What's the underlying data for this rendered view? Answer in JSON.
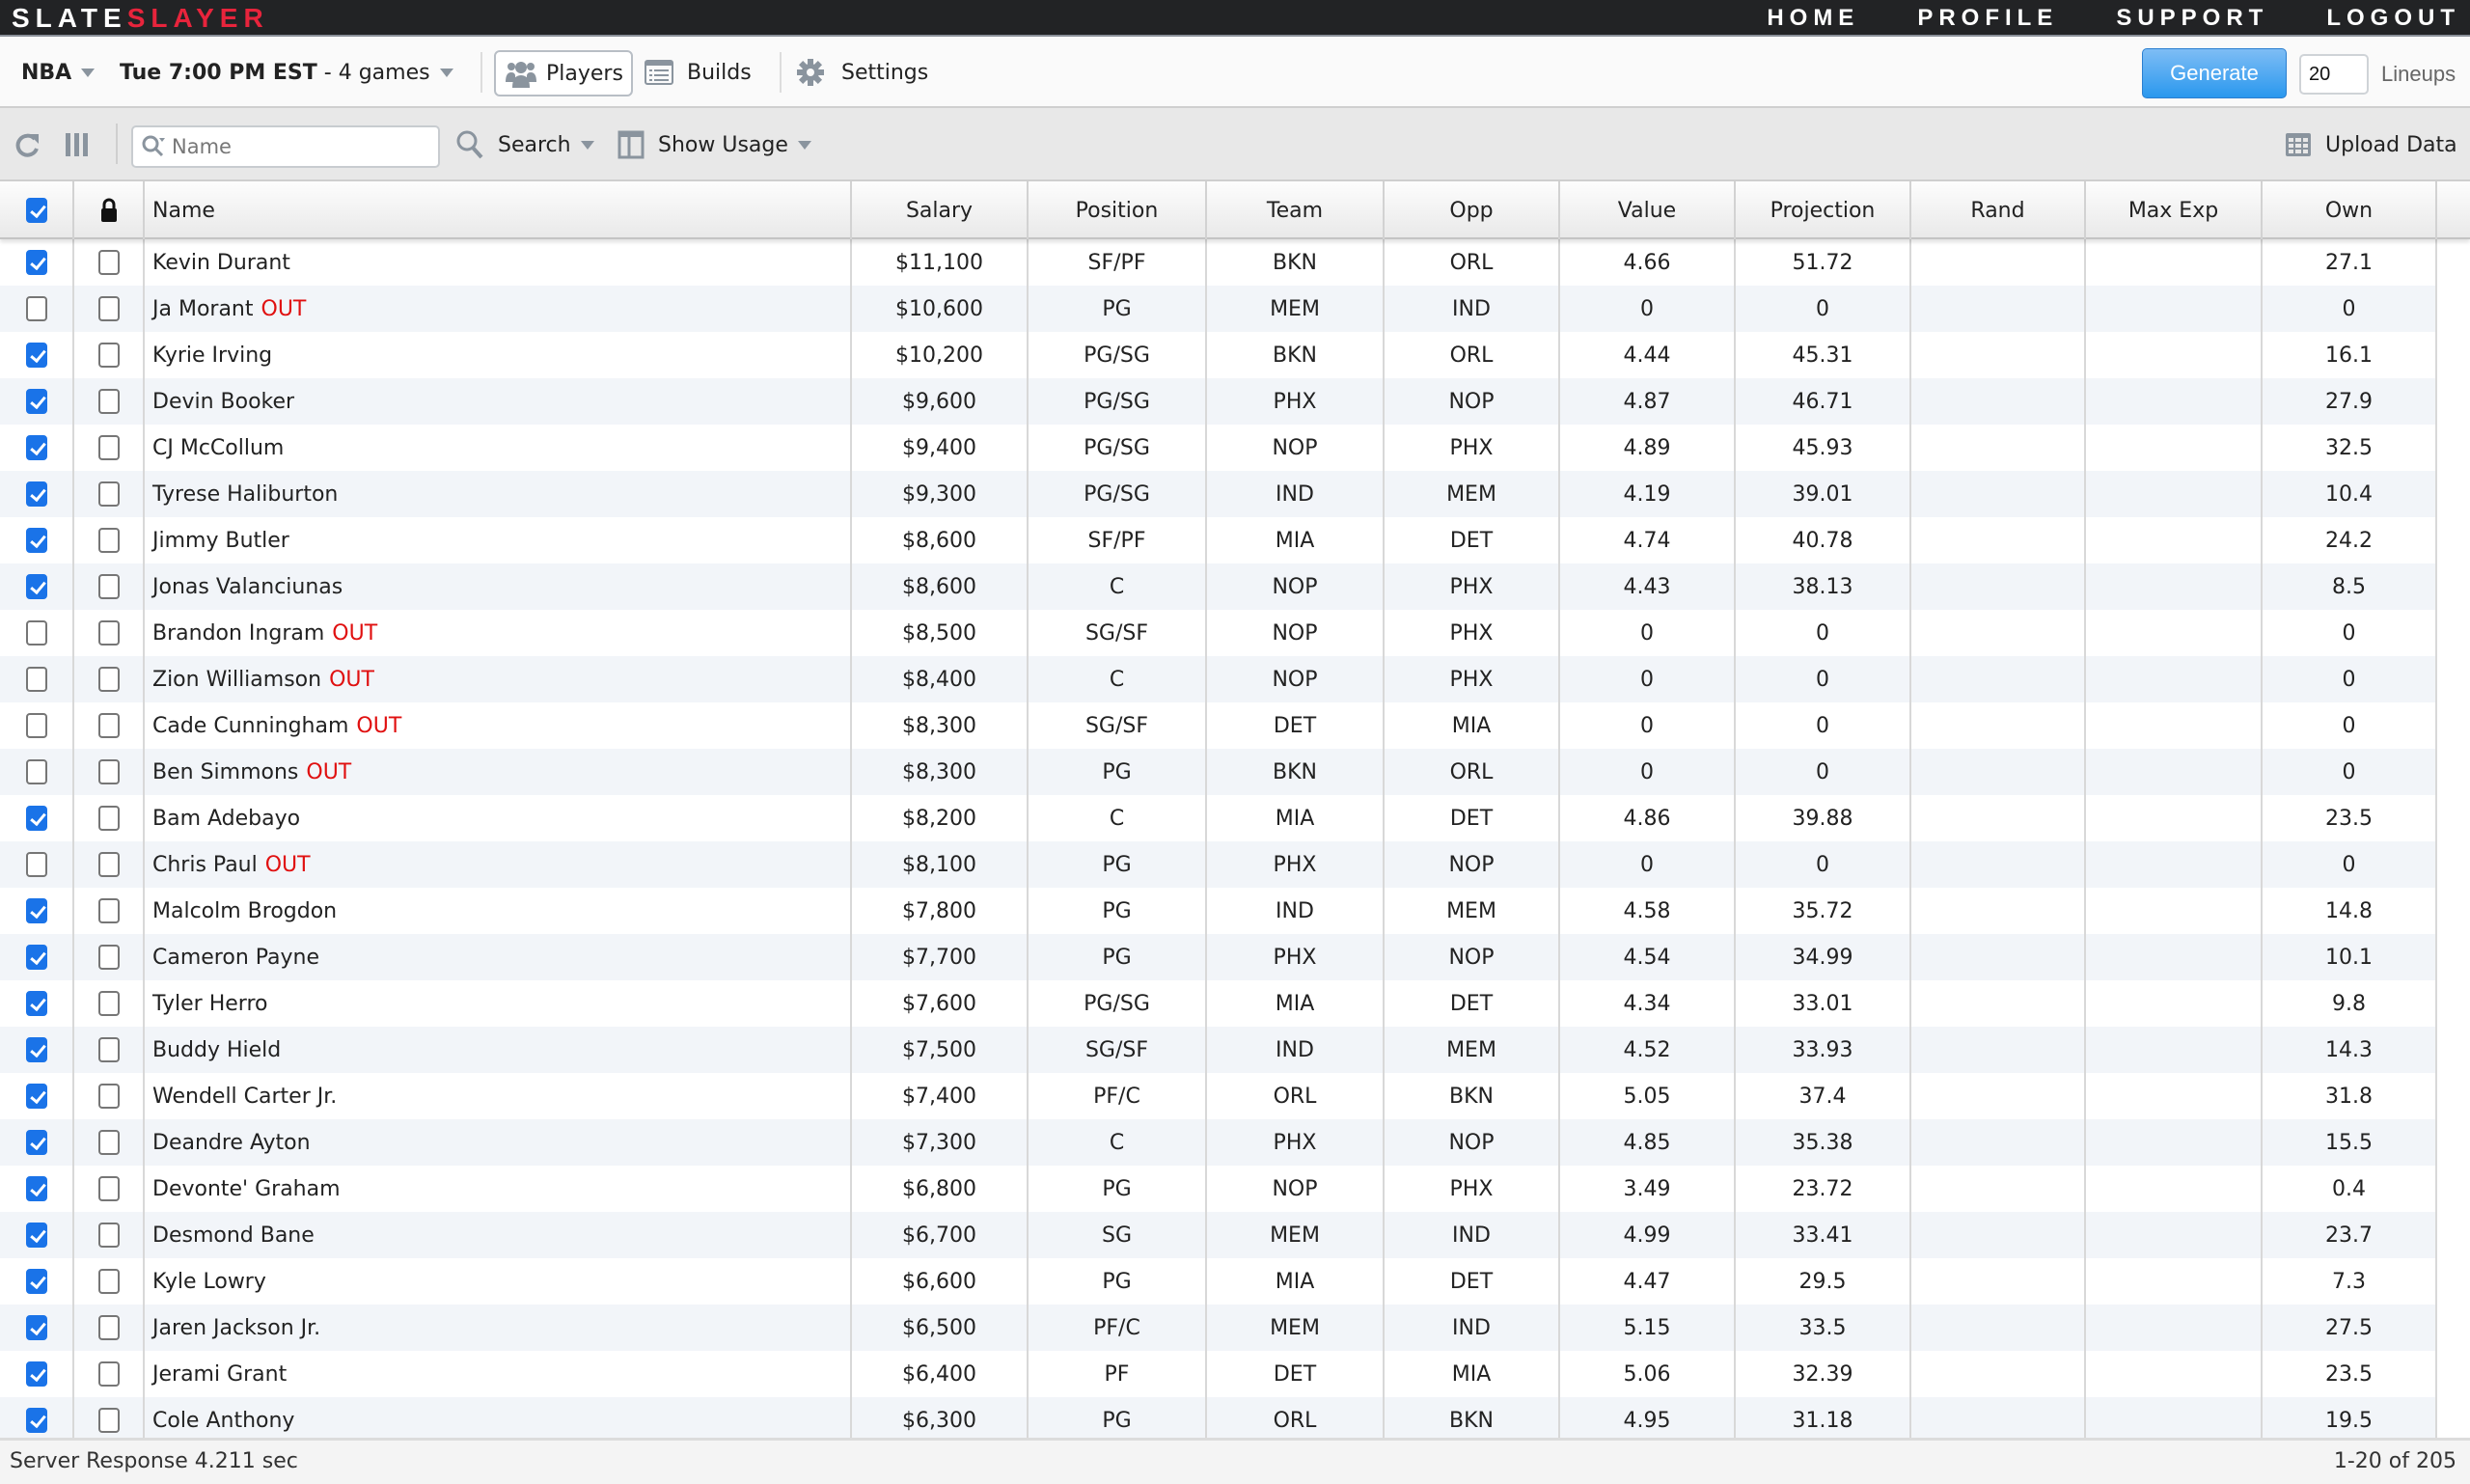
{
  "brand": {
    "part1": "SLATE",
    "part2": "SLAYER"
  },
  "nav": {
    "links": [
      "HOME",
      "PROFILE",
      "SUPPORT",
      "LOGOUT"
    ]
  },
  "toolbar": {
    "sport": "NBA",
    "slate_time": "Tue 7:00 PM EST",
    "slate_games": " - 4 games",
    "tabs": {
      "players": "Players",
      "builds": "Builds",
      "settings": "Settings"
    },
    "generate_label": "Generate",
    "lineups_value": "20",
    "lineups_label": "Lineups"
  },
  "filterbar": {
    "name_placeholder": "Name",
    "search_label": "Search",
    "show_usage_label": "Show Usage",
    "upload_label": "Upload Data"
  },
  "table": {
    "columns": [
      "Name",
      "Salary",
      "Position",
      "Team",
      "Opp",
      "Value",
      "Projection",
      "Rand",
      "Max Exp",
      "Own"
    ],
    "select_all_checked": true,
    "out_label": "OUT",
    "rows": [
      {
        "checked": true,
        "locked": false,
        "name": "Kevin Durant",
        "out": false,
        "salary": "$11,100",
        "position": "SF/PF",
        "team": "BKN",
        "opp": "ORL",
        "value": "4.66",
        "projection": "51.72",
        "rand": "",
        "max_exp": "",
        "own": "27.1"
      },
      {
        "checked": false,
        "locked": false,
        "name": "Ja Morant",
        "out": true,
        "salary": "$10,600",
        "position": "PG",
        "team": "MEM",
        "opp": "IND",
        "value": "0",
        "projection": "0",
        "rand": "",
        "max_exp": "",
        "own": "0"
      },
      {
        "checked": true,
        "locked": false,
        "name": "Kyrie Irving",
        "out": false,
        "salary": "$10,200",
        "position": "PG/SG",
        "team": "BKN",
        "opp": "ORL",
        "value": "4.44",
        "projection": "45.31",
        "rand": "",
        "max_exp": "",
        "own": "16.1"
      },
      {
        "checked": true,
        "locked": false,
        "name": "Devin Booker",
        "out": false,
        "salary": "$9,600",
        "position": "PG/SG",
        "team": "PHX",
        "opp": "NOP",
        "value": "4.87",
        "projection": "46.71",
        "rand": "",
        "max_exp": "",
        "own": "27.9"
      },
      {
        "checked": true,
        "locked": false,
        "name": "CJ McCollum",
        "out": false,
        "salary": "$9,400",
        "position": "PG/SG",
        "team": "NOP",
        "opp": "PHX",
        "value": "4.89",
        "projection": "45.93",
        "rand": "",
        "max_exp": "",
        "own": "32.5"
      },
      {
        "checked": true,
        "locked": false,
        "name": "Tyrese Haliburton",
        "out": false,
        "salary": "$9,300",
        "position": "PG/SG",
        "team": "IND",
        "opp": "MEM",
        "value": "4.19",
        "projection": "39.01",
        "rand": "",
        "max_exp": "",
        "own": "10.4"
      },
      {
        "checked": true,
        "locked": false,
        "name": "Jimmy Butler",
        "out": false,
        "salary": "$8,600",
        "position": "SF/PF",
        "team": "MIA",
        "opp": "DET",
        "value": "4.74",
        "projection": "40.78",
        "rand": "",
        "max_exp": "",
        "own": "24.2"
      },
      {
        "checked": true,
        "locked": false,
        "name": "Jonas Valanciunas",
        "out": false,
        "salary": "$8,600",
        "position": "C",
        "team": "NOP",
        "opp": "PHX",
        "value": "4.43",
        "projection": "38.13",
        "rand": "",
        "max_exp": "",
        "own": "8.5"
      },
      {
        "checked": false,
        "locked": false,
        "name": "Brandon Ingram",
        "out": true,
        "salary": "$8,500",
        "position": "SG/SF",
        "team": "NOP",
        "opp": "PHX",
        "value": "0",
        "projection": "0",
        "rand": "",
        "max_exp": "",
        "own": "0"
      },
      {
        "checked": false,
        "locked": false,
        "name": "Zion Williamson",
        "out": true,
        "salary": "$8,400",
        "position": "C",
        "team": "NOP",
        "opp": "PHX",
        "value": "0",
        "projection": "0",
        "rand": "",
        "max_exp": "",
        "own": "0"
      },
      {
        "checked": false,
        "locked": false,
        "name": "Cade Cunningham",
        "out": true,
        "salary": "$8,300",
        "position": "SG/SF",
        "team": "DET",
        "opp": "MIA",
        "value": "0",
        "projection": "0",
        "rand": "",
        "max_exp": "",
        "own": "0"
      },
      {
        "checked": false,
        "locked": false,
        "name": "Ben Simmons",
        "out": true,
        "salary": "$8,300",
        "position": "PG",
        "team": "BKN",
        "opp": "ORL",
        "value": "0",
        "projection": "0",
        "rand": "",
        "max_exp": "",
        "own": "0"
      },
      {
        "checked": true,
        "locked": false,
        "name": "Bam Adebayo",
        "out": false,
        "salary": "$8,200",
        "position": "C",
        "team": "MIA",
        "opp": "DET",
        "value": "4.86",
        "projection": "39.88",
        "rand": "",
        "max_exp": "",
        "own": "23.5"
      },
      {
        "checked": false,
        "locked": false,
        "name": "Chris Paul",
        "out": true,
        "salary": "$8,100",
        "position": "PG",
        "team": "PHX",
        "opp": "NOP",
        "value": "0",
        "projection": "0",
        "rand": "",
        "max_exp": "",
        "own": "0"
      },
      {
        "checked": true,
        "locked": false,
        "name": "Malcolm Brogdon",
        "out": false,
        "salary": "$7,800",
        "position": "PG",
        "team": "IND",
        "opp": "MEM",
        "value": "4.58",
        "projection": "35.72",
        "rand": "",
        "max_exp": "",
        "own": "14.8"
      },
      {
        "checked": true,
        "locked": false,
        "name": "Cameron Payne",
        "out": false,
        "salary": "$7,700",
        "position": "PG",
        "team": "PHX",
        "opp": "NOP",
        "value": "4.54",
        "projection": "34.99",
        "rand": "",
        "max_exp": "",
        "own": "10.1"
      },
      {
        "checked": true,
        "locked": false,
        "name": "Tyler Herro",
        "out": false,
        "salary": "$7,600",
        "position": "PG/SG",
        "team": "MIA",
        "opp": "DET",
        "value": "4.34",
        "projection": "33.01",
        "rand": "",
        "max_exp": "",
        "own": "9.8"
      },
      {
        "checked": true,
        "locked": false,
        "name": "Buddy Hield",
        "out": false,
        "salary": "$7,500",
        "position": "SG/SF",
        "team": "IND",
        "opp": "MEM",
        "value": "4.52",
        "projection": "33.93",
        "rand": "",
        "max_exp": "",
        "own": "14.3"
      },
      {
        "checked": true,
        "locked": false,
        "name": "Wendell Carter Jr.",
        "out": false,
        "salary": "$7,400",
        "position": "PF/C",
        "team": "ORL",
        "opp": "BKN",
        "value": "5.05",
        "projection": "37.4",
        "rand": "",
        "max_exp": "",
        "own": "31.8"
      },
      {
        "checked": true,
        "locked": false,
        "name": "Deandre Ayton",
        "out": false,
        "salary": "$7,300",
        "position": "C",
        "team": "PHX",
        "opp": "NOP",
        "value": "4.85",
        "projection": "35.38",
        "rand": "",
        "max_exp": "",
        "own": "15.5"
      },
      {
        "checked": true,
        "locked": false,
        "name": "Devonte' Graham",
        "out": false,
        "salary": "$6,800",
        "position": "PG",
        "team": "NOP",
        "opp": "PHX",
        "value": "3.49",
        "projection": "23.72",
        "rand": "",
        "max_exp": "",
        "own": "0.4"
      },
      {
        "checked": true,
        "locked": false,
        "name": "Desmond Bane",
        "out": false,
        "salary": "$6,700",
        "position": "SG",
        "team": "MEM",
        "opp": "IND",
        "value": "4.99",
        "projection": "33.41",
        "rand": "",
        "max_exp": "",
        "own": "23.7"
      },
      {
        "checked": true,
        "locked": false,
        "name": "Kyle Lowry",
        "out": false,
        "salary": "$6,600",
        "position": "PG",
        "team": "MIA",
        "opp": "DET",
        "value": "4.47",
        "projection": "29.5",
        "rand": "",
        "max_exp": "",
        "own": "7.3"
      },
      {
        "checked": true,
        "locked": false,
        "name": "Jaren Jackson Jr.",
        "out": false,
        "salary": "$6,500",
        "position": "PF/C",
        "team": "MEM",
        "opp": "IND",
        "value": "5.15",
        "projection": "33.5",
        "rand": "",
        "max_exp": "",
        "own": "27.5"
      },
      {
        "checked": true,
        "locked": false,
        "name": "Jerami Grant",
        "out": false,
        "salary": "$6,400",
        "position": "PF",
        "team": "DET",
        "opp": "MIA",
        "value": "5.06",
        "projection": "32.39",
        "rand": "",
        "max_exp": "",
        "own": "23.5"
      },
      {
        "checked": true,
        "locked": false,
        "name": "Cole Anthony",
        "out": false,
        "salary": "$6,300",
        "position": "PG",
        "team": "ORL",
        "opp": "BKN",
        "value": "4.95",
        "projection": "31.18",
        "rand": "",
        "max_exp": "",
        "own": "19.5"
      }
    ]
  },
  "footer": {
    "server_response": "Server Response 4.211 sec",
    "pagination": "1-20 of 205"
  },
  "colors": {
    "brand_red": "#e8243c",
    "accent_blue": "#2a98ee",
    "out_red": "#e01010"
  }
}
